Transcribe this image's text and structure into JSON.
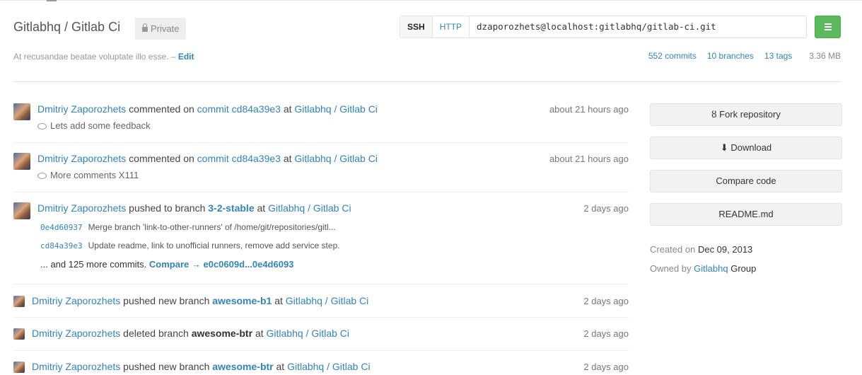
{
  "header": {
    "title": "Gitlabhq / Gitlab Ci",
    "visibility": "Private",
    "description": "At recusandae beatae voluptate illo esse.",
    "description_sep": " – ",
    "edit_label": "Edit"
  },
  "clone": {
    "ssh_label": "SSH",
    "http_label": "HTTP",
    "url": "dzaporozhets@localhost:gitlabhq/gitlab-ci.git"
  },
  "stats": {
    "commits": "552 commits",
    "branches": "10 branches",
    "tags": "13 tags",
    "size": "3.36 MB"
  },
  "events": [
    {
      "author": "Dmitriy Zaporozhets",
      "action": "commented on",
      "target": "commit cd84a39e3",
      "at": "at",
      "project": "Gitlabhq / Gitlab Ci",
      "time": "about 21 hours ago",
      "note": "Lets add some feedback"
    },
    {
      "author": "Dmitriy Zaporozhets",
      "action": "commented on",
      "target": "commit cd84a39e3",
      "at": "at",
      "project": "Gitlabhq / Gitlab Ci",
      "time": "about 21 hours ago",
      "note": "More comments X111"
    },
    {
      "author": "Dmitriy Zaporozhets",
      "action": "pushed to branch",
      "branch": "3-2-stable",
      "at": "at",
      "project": "Gitlabhq / Gitlab Ci",
      "time": "2 days ago",
      "commits": [
        {
          "sha": "0e4d60937",
          "message": "Merge branch 'link-to-other-runners' of /home/git/repositories/gitl..."
        },
        {
          "sha": "cd84a39e3",
          "message": "Update readme, link to unofficial runners, remove add service step."
        }
      ],
      "more_text": "... and 125 more commits.",
      "compare_text": "Compare → e0c0609d...0e4d6093"
    },
    {
      "author": "Dmitriy Zaporozhets",
      "action": "pushed new branch",
      "branch": "awesome-b1",
      "at": "at",
      "project": "Gitlabhq / Gitlab Ci",
      "time": "2 days ago"
    },
    {
      "author": "Dmitriy Zaporozhets",
      "action": "deleted branch",
      "branch": "awesome-btr",
      "at": "at",
      "project": "Gitlabhq / Gitlab Ci",
      "time": "2 days ago"
    },
    {
      "author": "Dmitriy Zaporozhets",
      "action": "pushed new branch",
      "branch": "awesome-btr",
      "at": "at",
      "project": "Gitlabhq / Gitlab Ci",
      "time": "2 days ago"
    }
  ],
  "sidebar": {
    "fork_label": "Fork repository",
    "download_label": "Download",
    "compare_label": "Compare code",
    "readme_label": "README.md",
    "created_prefix": "Created on",
    "created_date": "Dec 09, 2013",
    "owned_prefix": "Owned by",
    "owner": "Gitlabhq",
    "owner_suffix": "Group"
  },
  "colors": {
    "link": "#3084bb",
    "menu_button": "#5cb85c"
  }
}
